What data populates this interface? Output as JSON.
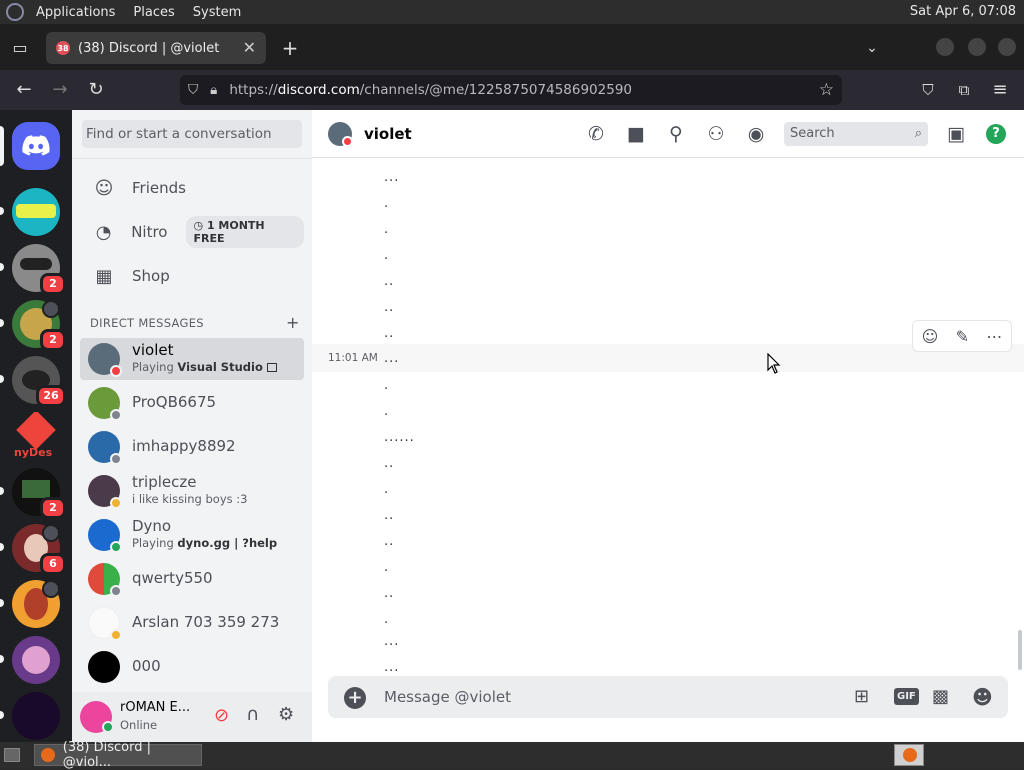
{
  "system": {
    "menus": [
      "Applications",
      "Places",
      "System"
    ],
    "clock": "Sat Apr  6, 07:08"
  },
  "browser": {
    "tab_title": "(38) Discord | @violet",
    "tab_badge": "38",
    "url_prefix": "https://",
    "url_domain": "discord.com",
    "url_path": "/channels/@me/1225875074586902590"
  },
  "discord": {
    "dm_search_placeholder": "Find or start a conversation",
    "nav": [
      {
        "label": "Friends",
        "icon": "friends-icon"
      },
      {
        "label": "Nitro",
        "icon": "nitro-icon",
        "badge": "1 MONTH FREE"
      },
      {
        "label": "Shop",
        "icon": "shop-icon"
      }
    ],
    "dm_header": "DIRECT MESSAGES",
    "dms": [
      {
        "name": "violet",
        "sub_prefix": "Playing ",
        "sub_bold": "Visual Studio",
        "status": "dnd",
        "avatar": "#5a6b7a"
      },
      {
        "name": "ProQB6675",
        "sub_prefix": "",
        "sub_bold": "",
        "status": "offline",
        "avatar": "#6a9a3a"
      },
      {
        "name": "imhappy8892",
        "sub_prefix": "",
        "sub_bold": "",
        "status": "offline",
        "avatar": "#2a6aa8"
      },
      {
        "name": "triplecze",
        "sub_prefix": "i like kissing boys :3",
        "sub_bold": "",
        "status": "idle",
        "avatar": "#4a3a4a"
      },
      {
        "name": "Dyno",
        "sub_prefix": "Playing ",
        "sub_bold": "dyno.gg | ?help",
        "status": "online",
        "avatar": "#1a6ad0"
      },
      {
        "name": "qwerty550",
        "sub_prefix": "",
        "sub_bold": "",
        "status": "offline",
        "avatar": "#3a3a3a"
      },
      {
        "name": "Arslan 703 359 273",
        "sub_prefix": "",
        "sub_bold": "",
        "status": "idle",
        "avatar": "#fafafa"
      },
      {
        "name": "000",
        "sub_prefix": "",
        "sub_bold": "",
        "status": "none",
        "avatar": "#000000"
      }
    ],
    "user": {
      "name": "rOMAN E...",
      "status": "Online"
    },
    "guild_badges": [
      "2",
      "2",
      "26",
      "2",
      "6"
    ],
    "guild_partial_label": "nyDes",
    "chat": {
      "channel_name": "violet",
      "search_placeholder": "Search",
      "timestamp": "11:01 AM",
      "messages": [
        "...",
        ".",
        ".",
        ".",
        "..",
        "..",
        "..",
        "...",
        ".",
        ".",
        "......",
        "..",
        ".",
        "..",
        "..",
        ".",
        "..",
        ".",
        "...",
        "..."
      ],
      "composer_placeholder": "Message @violet",
      "gif_label": "GIF"
    },
    "colors": {
      "blurple": "#5865f2",
      "dnd": "#f23f43",
      "idle": "#f0b232",
      "online": "#23a55a",
      "offline": "#80848e",
      "help": "#23a55a"
    }
  },
  "taskbar": {
    "item": "(38) Discord | @viol..."
  }
}
